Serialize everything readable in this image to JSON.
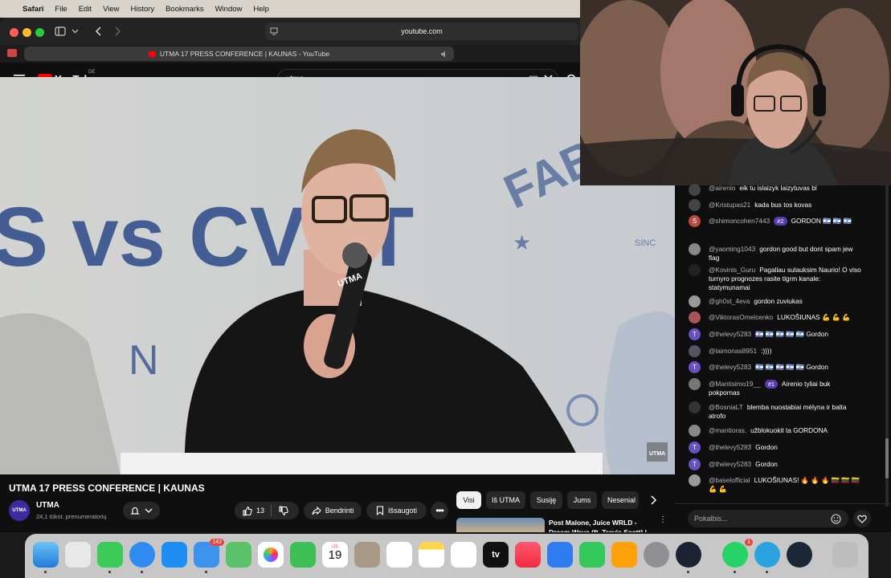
{
  "menubar": {
    "app": "Safari",
    "items": [
      "File",
      "Edit",
      "View",
      "History",
      "Bookmarks",
      "Window",
      "Help"
    ]
  },
  "safari": {
    "url": "youtube.com",
    "tab_title": "UTMA 17 PRESS CONFERENCE | KAUNAS - YouTube"
  },
  "youtube": {
    "logo": "YouTube",
    "region": "DE",
    "search_value": "utma",
    "video_title": "UTMA 17 PRESS CONFERENCE | KAUNAS",
    "channel": "UTMA",
    "channel_logo": "UTMA",
    "subscribers": "24,1 tūkst. prenumeratorių",
    "likes": "13",
    "share": "Bendrinti",
    "save": "Išsaugoti",
    "chips": [
      "Visi",
      "Iš UTMA",
      "Susiję",
      "Jums",
      "Nesenial"
    ],
    "next_video_title": "Post Malone, Juice WRLD - Dream Wave (ft. Travis Scott) |"
  },
  "video_overlay": {
    "big_text_left": "S vs CVET",
    "ng": "N G",
    "fab": "FAB",
    "since": "SINC",
    "mic_logo": "UTMA",
    "watermark": "UTMA"
  },
  "chat": {
    "input_placeholder": "Pokalbis...",
    "messages": [
      {
        "avatar": "",
        "user": "@airenio",
        "text": "eik tu islaizyk laizytuvas bl"
      },
      {
        "avatar": "",
        "user": "@Kristupas21",
        "text": "kada bus tos kovas"
      },
      {
        "avatar": "S",
        "user": "@shimoncohen7443",
        "badge": "#2",
        "text": "GORDON 🇮🇱 🇮🇱 🇮🇱"
      },
      {
        "avatar": "",
        "user": "@yaoming1043",
        "text": "gordon good but dont spam jew flag"
      },
      {
        "avatar": "",
        "user": "@Kovinis_Guru",
        "text": "Pagaliau sulauksim Naurio! O viso turnyro prognozes rasite tlgrm kanale: statymunamai"
      },
      {
        "avatar": "",
        "user": "@gh0st_4eva",
        "text": "gordon zuviukas"
      },
      {
        "avatar": "",
        "user": "@ViktorasOmelcenko",
        "text": "LUKOŠIUNAS 💪 💪 💪"
      },
      {
        "avatar": "T",
        "user": "@thelevy5283",
        "text": "🇮🇱 🇮🇱 🇮🇱 🇮🇱 🇮🇱 Gordon"
      },
      {
        "avatar": "",
        "user": "@laimonas8951",
        "text": ":))))"
      },
      {
        "avatar": "T",
        "user": "@thelevy5283",
        "text": "🇮🇱 🇮🇱 🇮🇱 🇮🇱 🇮🇱 Gordon"
      },
      {
        "avatar": "",
        "user": "@Mantisimo19__",
        "badge": "#1",
        "text": "Airenio tyliai buk pokpornas"
      },
      {
        "avatar": "",
        "user": "@BosniaLT",
        "text": "blemba nuostabiai mėlyna ir balta atrofo"
      },
      {
        "avatar": "",
        "user": "@mantioras.",
        "text": "užblokuokit ta GORDONA"
      },
      {
        "avatar": "T",
        "user": "@thelevy5283",
        "text": "Gordon"
      },
      {
        "avatar": "T",
        "user": "@thelevy5283",
        "text": "Gordon"
      },
      {
        "avatar": "",
        "user": "@baselofficial",
        "text": "LUKOŠIUNAS! 🔥 🔥 🔥 🇱🇹 🇱🇹 🇱🇹 💪 💪"
      }
    ]
  },
  "dock": {
    "calendar_month": "LIS",
    "calendar_day": "19",
    "mail_badge": "142",
    "whatsapp_badge": "1",
    "appletv": "tv"
  },
  "colors": {
    "yt_red": "#ff0000",
    "chat_bg": "#0f0f0f",
    "badge_purple": "#5b3bb0"
  }
}
